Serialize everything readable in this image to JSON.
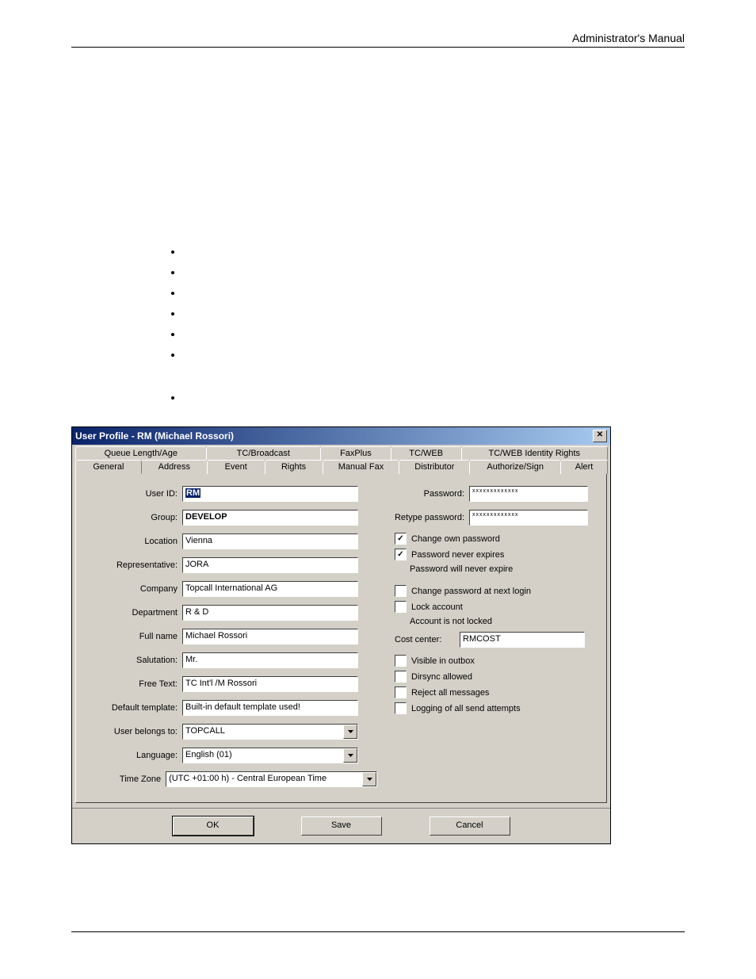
{
  "header": {
    "title": "Administrator's Manual"
  },
  "window": {
    "title": "User Profile - RM (Michael Rossori)",
    "tabs_row1": [
      "Queue Length/Age",
      "TC/Broadcast",
      "FaxPlus",
      "TC/WEB",
      "TC/WEB Identity Rights"
    ],
    "tabs_row2": [
      "General",
      "Address",
      "Event",
      "Rights",
      "Manual Fax",
      "Distributor",
      "Authorize/Sign",
      "Alert"
    ],
    "active_tab": "General"
  },
  "fields": {
    "user_id_label": "User ID:",
    "user_id": "RM",
    "group_label": "Group:",
    "group": "DEVELOP",
    "location_label": "Location",
    "location": "Vienna",
    "representative_label": "Representative:",
    "representative": "JORA",
    "company_label": "Company",
    "company": "Topcall International AG",
    "department_label": "Department",
    "department": "R & D",
    "fullname_label": "Full name",
    "fullname": "Michael Rossori",
    "salutation_label": "Salutation:",
    "salutation": "Mr.",
    "freetext_label": "Free Text:",
    "freetext": "TC Int'l /M Rossori",
    "default_template_label": "Default template:",
    "default_template": "Built-in default template used!",
    "user_belongs_label": "User belongs to:",
    "user_belongs": "TOPCALL",
    "language_label": "Language:",
    "language": "English (01)",
    "timezone_label": "Time Zone",
    "timezone": "(UTC +01:00 h) - Central European Time"
  },
  "right": {
    "password_label": "Password:",
    "password": "xxxxxxxxxxxxx",
    "retype_label": "Retype password:",
    "retype": "xxxxxxxxxxxxx",
    "change_own": "Change own password",
    "never_expires": "Password never expires",
    "will_never": "Password will never expire",
    "change_next": "Change password at next login",
    "lock_account": "Lock account",
    "account_not_locked": "Account is not locked",
    "cost_center_label": "Cost center:",
    "cost_center": "RMCOST",
    "visible_outbox": "Visible in outbox",
    "dirsync": "Dirsync allowed",
    "reject_all": "Reject all messages",
    "logging": "Logging of all send attempts"
  },
  "checks": {
    "change_own": true,
    "never_expires": true,
    "change_next": false,
    "lock_account": false,
    "visible_outbox": false,
    "dirsync": false,
    "reject_all": false,
    "logging": false
  },
  "buttons": {
    "ok": "OK",
    "save": "Save",
    "cancel": "Cancel"
  }
}
